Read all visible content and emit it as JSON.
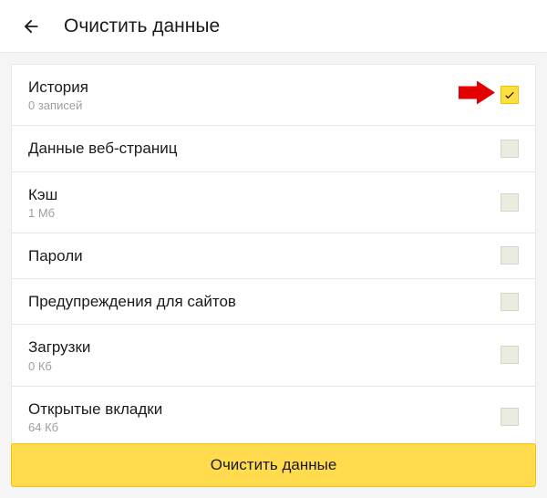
{
  "header": {
    "title": "Очистить данные"
  },
  "items": [
    {
      "label": "История",
      "sub": "0 записей",
      "checked": true,
      "annotated": true
    },
    {
      "label": "Данные веб-страниц",
      "sub": "",
      "checked": false,
      "annotated": false
    },
    {
      "label": "Кэш",
      "sub": "1 Мб",
      "checked": false,
      "annotated": false
    },
    {
      "label": "Пароли",
      "sub": "",
      "checked": false,
      "annotated": false
    },
    {
      "label": "Предупреждения для сайтов",
      "sub": "",
      "checked": false,
      "annotated": false
    },
    {
      "label": "Загрузки",
      "sub": "0 Кб",
      "checked": false,
      "annotated": false
    },
    {
      "label": "Открытые вкладки",
      "sub": "64 Кб",
      "checked": false,
      "annotated": false
    }
  ],
  "button": {
    "label": "Очистить данные"
  }
}
